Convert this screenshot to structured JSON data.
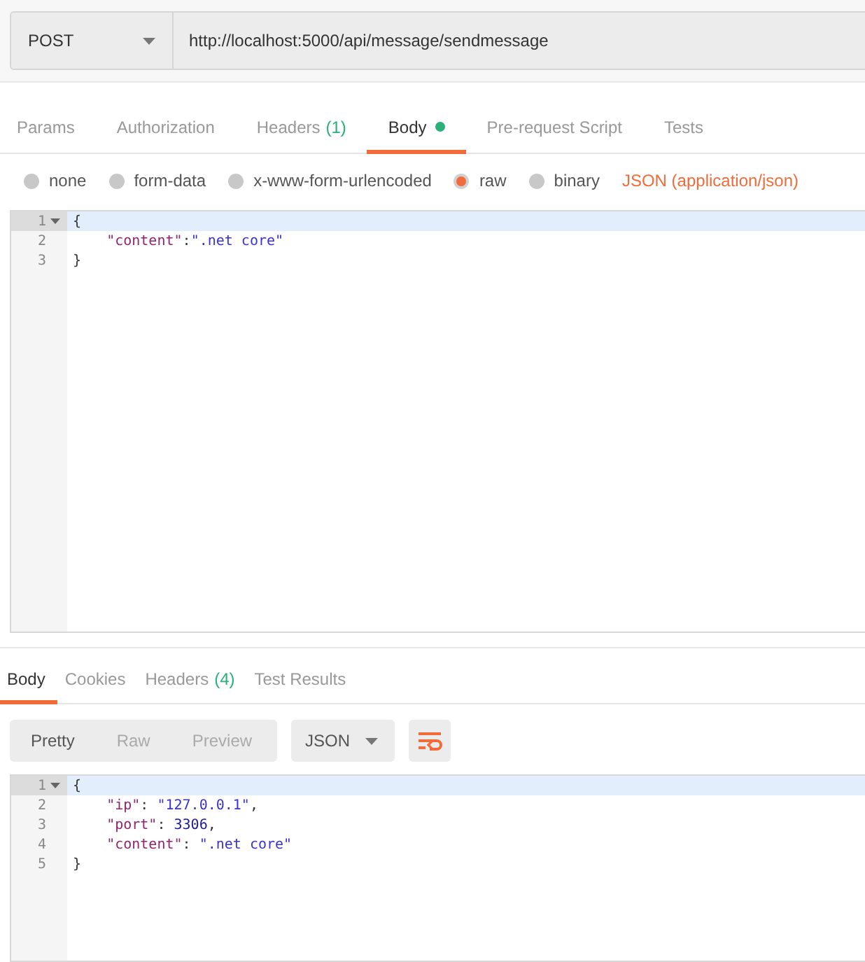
{
  "request": {
    "method": "POST",
    "url": "http://localhost:5000/api/message/sendmessage"
  },
  "request_tabs": [
    {
      "label": "Params",
      "dot": false,
      "selected": false
    },
    {
      "label": "Authorization",
      "dot": false,
      "selected": false
    },
    {
      "label": "Headers",
      "count": "(1)",
      "dot": false,
      "selected": false
    },
    {
      "label": "Body",
      "dot": true,
      "selected": true
    },
    {
      "label": "Pre-request Script",
      "dot": false,
      "selected": false
    },
    {
      "label": "Tests",
      "dot": false,
      "selected": false
    }
  ],
  "body_types": [
    {
      "label": "none",
      "selected": false
    },
    {
      "label": "form-data",
      "selected": false
    },
    {
      "label": "x-www-form-urlencoded",
      "selected": false
    },
    {
      "label": "raw",
      "selected": true
    },
    {
      "label": "binary",
      "selected": false
    }
  ],
  "body_format": "JSON (application/json)",
  "request_body": [
    {
      "number": "1",
      "foldable": true,
      "active": true,
      "tokens": [
        {
          "kind": "punct",
          "text": "{"
        }
      ]
    },
    {
      "number": "2",
      "foldable": false,
      "active": false,
      "tokens": [
        {
          "kind": "key",
          "text": "    \"content\""
        },
        {
          "kind": "punct",
          "text": ":"
        },
        {
          "kind": "string",
          "text": "\".net core\""
        }
      ]
    },
    {
      "number": "3",
      "foldable": false,
      "active": false,
      "tokens": [
        {
          "kind": "punct",
          "text": "}"
        }
      ]
    }
  ],
  "response_tabs": [
    {
      "label": "Body",
      "selected": true
    },
    {
      "label": "Cookies",
      "selected": false
    },
    {
      "label": "Headers",
      "count": "(4)",
      "selected": false
    },
    {
      "label": "Test Results",
      "selected": false
    }
  ],
  "view_modes": [
    {
      "label": "Pretty",
      "selected": true
    },
    {
      "label": "Raw",
      "selected": false
    },
    {
      "label": "Preview",
      "selected": false
    }
  ],
  "response_format": "JSON",
  "response_body": [
    {
      "number": "1",
      "foldable": true,
      "active": true,
      "tokens": [
        {
          "kind": "punct",
          "text": "{"
        }
      ]
    },
    {
      "number": "2",
      "foldable": false,
      "active": false,
      "tokens": [
        {
          "kind": "key",
          "text": "    \"ip\""
        },
        {
          "kind": "punct",
          "text": ": "
        },
        {
          "kind": "string",
          "text": "\"127.0.0.1\""
        },
        {
          "kind": "punct",
          "text": ","
        }
      ]
    },
    {
      "number": "3",
      "foldable": false,
      "active": false,
      "tokens": [
        {
          "kind": "key",
          "text": "    \"port\""
        },
        {
          "kind": "punct",
          "text": ": "
        },
        {
          "kind": "number",
          "text": "3306"
        },
        {
          "kind": "punct",
          "text": ","
        }
      ]
    },
    {
      "number": "4",
      "foldable": false,
      "active": false,
      "tokens": [
        {
          "kind": "key",
          "text": "    \"content\""
        },
        {
          "kind": "punct",
          "text": ": "
        },
        {
          "kind": "string",
          "text": "\".net core\""
        }
      ]
    },
    {
      "number": "5",
      "foldable": false,
      "active": false,
      "tokens": [
        {
          "kind": "punct",
          "text": "}"
        }
      ]
    }
  ]
}
